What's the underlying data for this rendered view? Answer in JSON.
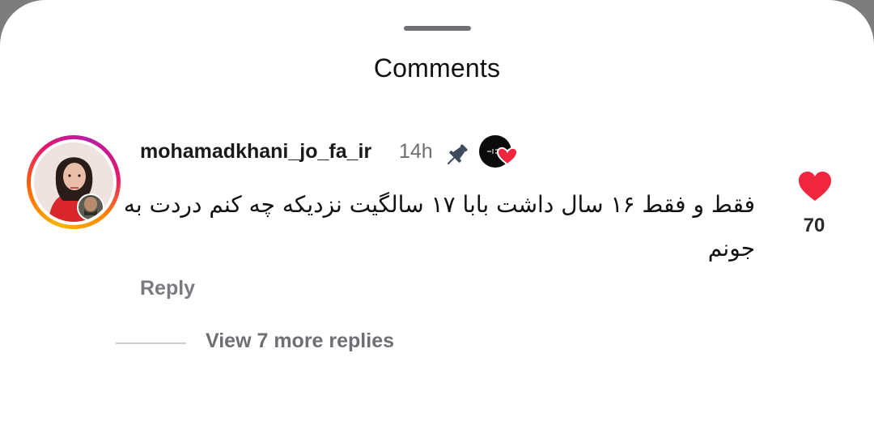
{
  "sheet": {
    "title": "Comments"
  },
  "comment": {
    "username": "mohamadkhani_jo_fa_ir",
    "time": "14h",
    "text": "فقط و فقط ۱۶ سال داشت بابا ۱۷ سالگیت نزدیکه چه کنم دردت به جونم",
    "likes": "70",
    "reply_label": "Reply",
    "view_more_label": "View 7 more replies",
    "icons": {
      "pin": "pin-icon",
      "like": "heart-icon",
      "creator_badge": "creator-liked-badge-icon"
    }
  },
  "colors": {
    "heart": "#f0263f",
    "text": "#111111",
    "secondary": "#6e6e73"
  }
}
